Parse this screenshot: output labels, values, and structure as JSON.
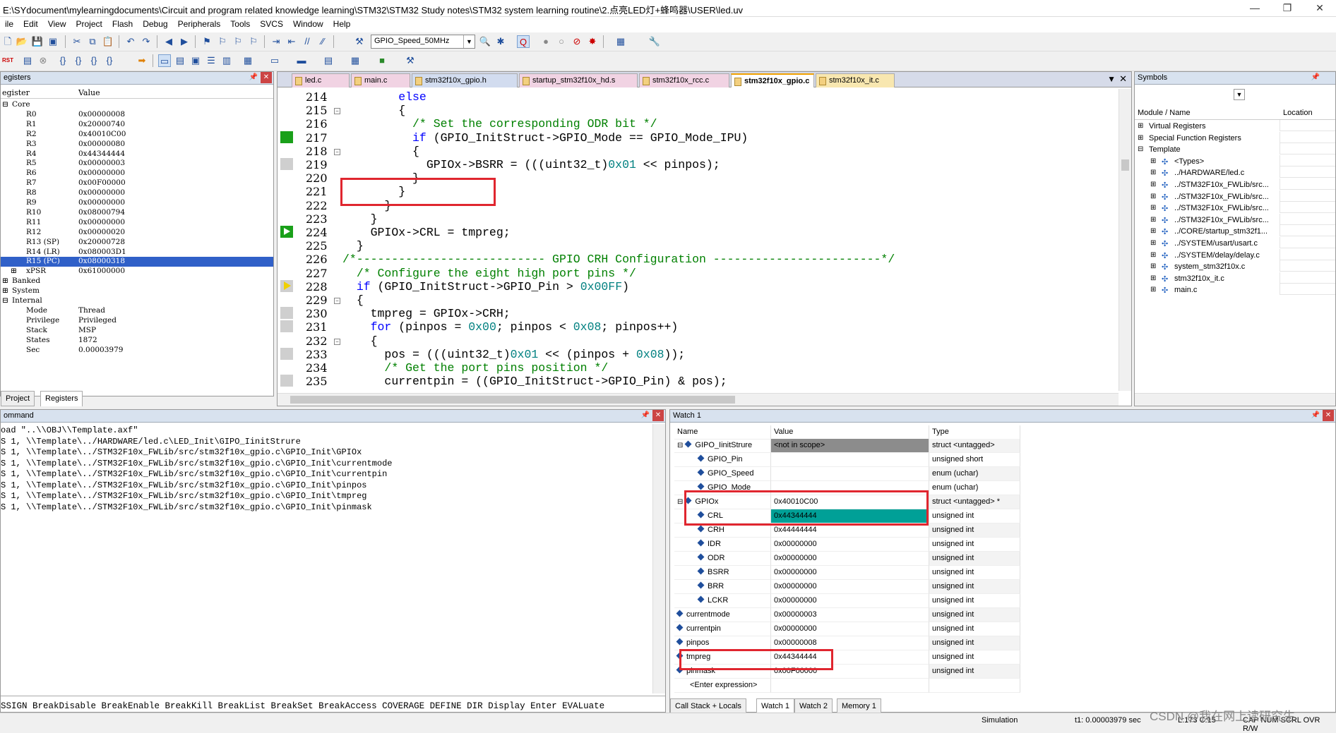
{
  "window": {
    "title": "E:\\SYdocument\\mylearningdocuments\\Circuit and program related knowledge learning\\STM32\\STM32 Study notes\\STM32 system learning routine\\2.点亮LED灯+蜂鸣器\\USER\\led.uv",
    "min": "—",
    "max": "❐",
    "close": "✕"
  },
  "menu": [
    "ile",
    "Edit",
    "View",
    "Project",
    "Flash",
    "Debug",
    "Peripherals",
    "Tools",
    "SVCS",
    "Window",
    "Help"
  ],
  "toolbar": {
    "combo_value": "GPIO_Speed_50MHz",
    "rst_label": "RST"
  },
  "registers": {
    "title": "egisters",
    "col_register": "egister",
    "col_value": "Value",
    "rows": [
      {
        "name": "Core",
        "value": "",
        "indent": 0,
        "tree": "⊟"
      },
      {
        "name": "R0",
        "value": "0x00000008",
        "indent": 2
      },
      {
        "name": "R1",
        "value": "0x20000740",
        "indent": 2
      },
      {
        "name": "R2",
        "value": "0x40010C00",
        "indent": 2
      },
      {
        "name": "R3",
        "value": "0x00000080",
        "indent": 2
      },
      {
        "name": "R4",
        "value": "0x44344444",
        "indent": 2
      },
      {
        "name": "R5",
        "value": "0x00000003",
        "indent": 2
      },
      {
        "name": "R6",
        "value": "0x00000000",
        "indent": 2
      },
      {
        "name": "R7",
        "value": "0x00F00000",
        "indent": 2
      },
      {
        "name": "R8",
        "value": "0x00000000",
        "indent": 2
      },
      {
        "name": "R9",
        "value": "0x00000000",
        "indent": 2
      },
      {
        "name": "R10",
        "value": "0x08000794",
        "indent": 2
      },
      {
        "name": "R11",
        "value": "0x00000000",
        "indent": 2
      },
      {
        "name": "R12",
        "value": "0x00000020",
        "indent": 2
      },
      {
        "name": "R13 (SP)",
        "value": "0x20000728",
        "indent": 2
      },
      {
        "name": "R14 (LR)",
        "value": "0x080003D1",
        "indent": 2
      },
      {
        "name": "R15 (PC)",
        "value": "0x08000318",
        "indent": 2,
        "selected": true
      },
      {
        "name": "xPSR",
        "value": "0x61000000",
        "indent": 2,
        "tree": "⊞"
      },
      {
        "name": "Banked",
        "value": "",
        "indent": 0,
        "tree": "⊞"
      },
      {
        "name": "System",
        "value": "",
        "indent": 0,
        "tree": "⊞"
      },
      {
        "name": "Internal",
        "value": "",
        "indent": 0,
        "tree": "⊟"
      },
      {
        "name": "Mode",
        "value": "Thread",
        "indent": 2
      },
      {
        "name": "Privilege",
        "value": "Privileged",
        "indent": 2
      },
      {
        "name": "Stack",
        "value": "MSP",
        "indent": 2
      },
      {
        "name": "States",
        "value": "1872",
        "indent": 2
      },
      {
        "name": "Sec",
        "value": "0.00003979",
        "indent": 2
      }
    ],
    "tabs": [
      "Project",
      "Registers"
    ]
  },
  "editor": {
    "tabs": [
      {
        "label": "led.c",
        "color": "#f1d3e3"
      },
      {
        "label": "main.c",
        "color": "#f1d3e3"
      },
      {
        "label": "stm32f10x_gpio.h",
        "color": "#d2dcef"
      },
      {
        "label": "startup_stm32f10x_hd.s",
        "color": "#f1d3e3"
      },
      {
        "label": "stm32f10x_rcc.c",
        "color": "#f1d3e3"
      },
      {
        "label": "stm32f10x_gpio.c",
        "color": "#ffffff",
        "active": true
      },
      {
        "label": "stm32f10x_it.c",
        "color": "#f8e7b0"
      }
    ],
    "lines": [
      {
        "n": "214",
        "indent": "        ",
        "parts": [
          [
            "kw",
            "else"
          ]
        ]
      },
      {
        "n": "215",
        "indent": "        ",
        "parts": [
          [
            "",
            "{"
          ]
        ],
        "fold": "−"
      },
      {
        "n": "216",
        "indent": "          ",
        "parts": [
          [
            "cm",
            "/* Set the corresponding ODR bit */"
          ]
        ]
      },
      {
        "n": "217",
        "indent": "          ",
        "parts": [
          [
            "kw",
            "if"
          ],
          [
            "",
            " (GPIO_InitStruct->GPIO_Mode == GPIO_Mode_IPU)"
          ]
        ],
        "mark": "green"
      },
      {
        "n": "218",
        "indent": "          ",
        "parts": [
          [
            "",
            "{"
          ]
        ],
        "fold": "−"
      },
      {
        "n": "219",
        "indent": "            ",
        "parts": [
          [
            "",
            "GPIOx->BSRR = (((uint32_t)"
          ],
          [
            "nm",
            "0x01"
          ],
          [
            "",
            " << pinpos);"
          ]
        ],
        "mark": "gray"
      },
      {
        "n": "220",
        "indent": "          ",
        "parts": [
          [
            "",
            "}"
          ]
        ]
      },
      {
        "n": "221",
        "indent": "        ",
        "parts": [
          [
            "",
            "}"
          ]
        ]
      },
      {
        "n": "222",
        "indent": "      ",
        "parts": [
          [
            "",
            "}"
          ]
        ]
      },
      {
        "n": "223",
        "indent": "    ",
        "parts": [
          [
            "",
            "}"
          ]
        ]
      },
      {
        "n": "224",
        "indent": "    ",
        "parts": [
          [
            "",
            "GPIOx->CRL = tmpreg;"
          ]
        ],
        "mark": "arrow"
      },
      {
        "n": "225",
        "indent": "  ",
        "parts": [
          [
            "",
            "}"
          ]
        ]
      },
      {
        "n": "226",
        "indent": "",
        "parts": [
          [
            "cm",
            "/*--------------------------- GPIO CRH Configuration ------------------------*/"
          ]
        ]
      },
      {
        "n": "227",
        "indent": "  ",
        "parts": [
          [
            "cm",
            "/* Configure the eight high port pins */"
          ]
        ]
      },
      {
        "n": "228",
        "indent": "  ",
        "parts": [
          [
            "kw",
            "if"
          ],
          [
            "",
            " (GPIO_InitStruct->GPIO_Pin > "
          ],
          [
            "nm",
            "0x00FF"
          ],
          [
            "",
            ")"
          ]
        ],
        "mark": "yellow"
      },
      {
        "n": "229",
        "indent": "  ",
        "parts": [
          [
            "",
            "{"
          ]
        ],
        "fold": "−"
      },
      {
        "n": "230",
        "indent": "    ",
        "parts": [
          [
            "",
            "tmpreg = GPIOx->CRH;"
          ]
        ],
        "mark": "gray"
      },
      {
        "n": "231",
        "indent": "    ",
        "parts": [
          [
            "kw",
            "for"
          ],
          [
            "",
            " (pinpos = "
          ],
          [
            "nm",
            "0x00"
          ],
          [
            "",
            "; pinpos < "
          ],
          [
            "nm",
            "0x08"
          ],
          [
            "",
            "; pinpos++)"
          ]
        ],
        "mark": "gray"
      },
      {
        "n": "232",
        "indent": "    ",
        "parts": [
          [
            "",
            "{"
          ]
        ],
        "fold": "−"
      },
      {
        "n": "233",
        "indent": "      ",
        "parts": [
          [
            "",
            "pos = (((uint32_t)"
          ],
          [
            "nm",
            "0x01"
          ],
          [
            "",
            " << (pinpos + "
          ],
          [
            "nm",
            "0x08"
          ],
          [
            "",
            "));"
          ]
        ],
        "mark": "gray"
      },
      {
        "n": "234",
        "indent": "      ",
        "parts": [
          [
            "cm",
            "/* Get the port pins position */"
          ]
        ]
      },
      {
        "n": "235",
        "indent": "      ",
        "parts": [
          [
            "",
            "currentpin = ((GPIO_InitStruct->GPIO_Pin) & pos);"
          ]
        ],
        "mark": "gray"
      }
    ]
  },
  "symbols": {
    "title": "Symbols",
    "col_module": "Module / Name",
    "col_location": "Location",
    "rows": [
      {
        "label": "Virtual Registers",
        "depth": 0,
        "exp": "⊞"
      },
      {
        "label": "Special Function Registers",
        "depth": 0,
        "exp": "⊞"
      },
      {
        "label": "Template",
        "depth": 0,
        "exp": "⊟"
      },
      {
        "label": "<Types>",
        "depth": 1,
        "exp": "⊞"
      },
      {
        "label": "../HARDWARE/led.c",
        "depth": 1,
        "exp": "⊞"
      },
      {
        "label": "../STM32F10x_FWLib/src...",
        "depth": 1,
        "exp": "⊞"
      },
      {
        "label": "../STM32F10x_FWLib/src...",
        "depth": 1,
        "exp": "⊞"
      },
      {
        "label": "../STM32F10x_FWLib/src...",
        "depth": 1,
        "exp": "⊞"
      },
      {
        "label": "../STM32F10x_FWLib/src...",
        "depth": 1,
        "exp": "⊞"
      },
      {
        "label": "../CORE/startup_stm32f1...",
        "depth": 1,
        "exp": "⊞"
      },
      {
        "label": "../SYSTEM/usart/usart.c",
        "depth": 1,
        "exp": "⊞"
      },
      {
        "label": "../SYSTEM/delay/delay.c",
        "depth": 1,
        "exp": "⊞"
      },
      {
        "label": "system_stm32f10x.c",
        "depth": 1,
        "exp": "⊞"
      },
      {
        "label": "stm32f10x_it.c",
        "depth": 1,
        "exp": "⊞"
      },
      {
        "label": "main.c",
        "depth": 1,
        "exp": "⊞"
      }
    ]
  },
  "command": {
    "title": "ommand",
    "lines": [
      "oad \"..\\\\OBJ\\\\Template.axf\"",
      "S 1, \\\\Template\\../HARDWARE/led.c\\LED_Init\\GIPO_IinitStrure",
      "S 1, \\\\Template\\../STM32F10x_FWLib/src/stm32f10x_gpio.c\\GPIO_Init\\GPIOx",
      "S 1, \\\\Template\\../STM32F10x_FWLib/src/stm32f10x_gpio.c\\GPIO_Init\\currentmode",
      "S 1, \\\\Template\\../STM32F10x_FWLib/src/stm32f10x_gpio.c\\GPIO_Init\\currentpin",
      "S 1, \\\\Template\\../STM32F10x_FWLib/src/stm32f10x_gpio.c\\GPIO_Init\\pinpos",
      "S 1, \\\\Template\\../STM32F10x_FWLib/src/stm32f10x_gpio.c\\GPIO_Init\\tmpreg",
      "S 1, \\\\Template\\../STM32F10x_FWLib/src/stm32f10x_gpio.c\\GPIO_Init\\pinmask"
    ],
    "help": "SSIGN BreakDisable BreakEnable BreakKill BreakList BreakSet BreakAccess COVERAGE DEFINE DIR Display Enter EVALuate"
  },
  "watch": {
    "title": "Watch 1",
    "col_name": "Name",
    "col_value": "Value",
    "col_type": "Type",
    "rows": [
      {
        "name": "GIPO_IinitStrure",
        "value": "<not in scope>",
        "type": "struct <untagged>",
        "depth": 0,
        "exp": "⊟",
        "valstyle": "gray"
      },
      {
        "name": "GPIO_Pin",
        "value": "",
        "type": "unsigned short",
        "depth": 1
      },
      {
        "name": "GPIO_Speed",
        "value": "",
        "type": "enum (uchar)",
        "depth": 1
      },
      {
        "name": "GPIO_Mode",
        "value": "",
        "type": "enum (uchar)",
        "depth": 1
      },
      {
        "name": "GPIOx",
        "value": "0x40010C00",
        "type": "struct <untagged> *",
        "depth": 0,
        "exp": "⊟"
      },
      {
        "name": "CRL",
        "value": "0x44344444",
        "type": "unsigned int",
        "depth": 1,
        "valstyle": "teal"
      },
      {
        "name": "CRH",
        "value": "0x44444444",
        "type": "unsigned int",
        "depth": 1
      },
      {
        "name": "IDR",
        "value": "0x00000000",
        "type": "unsigned int",
        "depth": 1
      },
      {
        "name": "ODR",
        "value": "0x00000000",
        "type": "unsigned int",
        "depth": 1
      },
      {
        "name": "BSRR",
        "value": "0x00000000",
        "type": "unsigned int",
        "depth": 1
      },
      {
        "name": "BRR",
        "value": "0x00000000",
        "type": "unsigned int",
        "depth": 1
      },
      {
        "name": "LCKR",
        "value": "0x00000000",
        "type": "unsigned int",
        "depth": 1
      },
      {
        "name": "currentmode",
        "value": "0x00000003",
        "type": "unsigned int",
        "depth": 0
      },
      {
        "name": "currentpin",
        "value": "0x00000000",
        "type": "unsigned int",
        "depth": 0
      },
      {
        "name": "pinpos",
        "value": "0x00000008",
        "type": "unsigned int",
        "depth": 0
      },
      {
        "name": "tmpreg",
        "value": "0x44344444",
        "type": "unsigned int",
        "depth": 0
      },
      {
        "name": "pinmask",
        "value": "0x00F00000",
        "type": "unsigned int",
        "depth": 0
      },
      {
        "name": "<Enter expression>",
        "value": "",
        "type": "",
        "depth": 0
      }
    ],
    "tabs": [
      "Call Stack + Locals",
      "Watch 1",
      "Watch 2",
      "Memory 1"
    ]
  },
  "status": {
    "mode": "Simulation",
    "time": "t1: 0.00003979 sec",
    "pos": "L:173 C:15",
    "caps": "CAP  NUM  SCRL  OVR  R/W",
    "watermark": "CSDN @我在网上读研究生"
  }
}
